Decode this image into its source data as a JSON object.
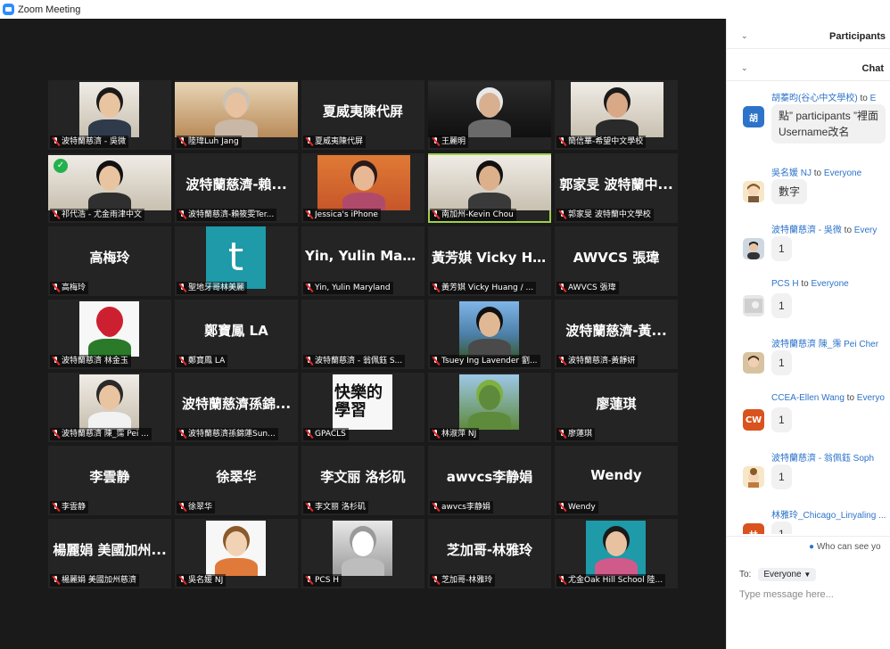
{
  "window": {
    "title": "Zoom Meeting"
  },
  "tiles": [
    {
      "label": "波特蘭慈濟 - 吳微",
      "big": ""
    },
    {
      "label": "陸瑋Luh Jang",
      "big": ""
    },
    {
      "label": "夏威夷陳代屏",
      "big": "夏威夷陳代屏"
    },
    {
      "label": "王麗明",
      "big": ""
    },
    {
      "label": "簡信華-希望中文學校",
      "big": ""
    },
    {
      "label": "祁代浩 - 尤金雨津中文",
      "big": ""
    },
    {
      "label": "波特蘭慈濟-賴筱雯Ter...",
      "big": "波特蘭慈濟-賴..."
    },
    {
      "label": "Jessica's iPhone",
      "big": ""
    },
    {
      "label": "南加州-Kevin Chou",
      "big": ""
    },
    {
      "label": "郭家旻 波特蘭中文學校",
      "big": "郭家旻 波特蘭中..."
    },
    {
      "label": "高梅玲",
      "big": "高梅玲"
    },
    {
      "label": "聖地牙哥林美麗",
      "big": ""
    },
    {
      "label": "Yin, Yulin  Maryland",
      "big": "Yin, Yulin  Maryl..."
    },
    {
      "label": "黃芳娸 Vicky Huang / ...",
      "big": "黃芳娸 Vicky Hu..."
    },
    {
      "label": "AWVCS 張瑋",
      "big": "AWVCS 張瑋"
    },
    {
      "label": "波特蘭慈濟 林金玉",
      "big": ""
    },
    {
      "label": "鄭寶鳳 LA",
      "big": "鄭寶鳳 LA"
    },
    {
      "label": "波特蘭慈濟 - 翁佩鈺 S...",
      "big": ""
    },
    {
      "label": "Tsuey Ing Lavender 劉...",
      "big": ""
    },
    {
      "label": "波特蘭慈濟-黃靜妍",
      "big": "波特蘭慈濟-黃..."
    },
    {
      "label": "波特蘭慈濟 陳_霈 Pei ...",
      "big": ""
    },
    {
      "label": "波特蘭慈濟孫錦蓮Sun...",
      "big": "波特蘭慈濟孫錦..."
    },
    {
      "label": "GPACLS",
      "big": ""
    },
    {
      "label": "林淑萍 NJ",
      "big": ""
    },
    {
      "label": "廖蓮琪",
      "big": "廖蓮琪"
    },
    {
      "label": "李雲静",
      "big": "李雲静"
    },
    {
      "label": "徐翠华",
      "big": "徐翠华"
    },
    {
      "label": "李文丽 洛杉矶",
      "big": "李文丽 洛杉矶"
    },
    {
      "label": "awvcs李静娟",
      "big": "awvcs李静娟"
    },
    {
      "label": "Wendy",
      "big": "Wendy"
    },
    {
      "label": "楊麗娟 美國加州慈濟",
      "big": "楊麗娟 美國加州..."
    },
    {
      "label": "吳名媛 NJ",
      "big": ""
    },
    {
      "label": "PCS H",
      "big": ""
    },
    {
      "label": "芝加哥-林雅玲",
      "big": "芝加哥-林雅玲"
    },
    {
      "label": "尤金Oak Hill School 陸...",
      "big": ""
    }
  ],
  "tile_logo_letter": "t",
  "calligraphy": "快樂的學習",
  "sidebar": {
    "participants_title": "Participants",
    "chat_title": "Chat",
    "messages": [
      {
        "from": "胡蓁昀(谷心中文學校)",
        "to_word": "to",
        "to": "E",
        "avatar_text": "胡",
        "text1": "點” participants ”裡面",
        "text2": "Username改名"
      },
      {
        "from": "吳名媛 NJ",
        "to_word": "to",
        "to": "Everyone",
        "avatar_text": "",
        "text1": "數字"
      },
      {
        "from": "波特蘭慈濟 - 吳微",
        "to_word": "to",
        "to": "Every",
        "avatar_text": "",
        "text1": "1"
      },
      {
        "from": "PCS H",
        "to_word": "to",
        "to": "Everyone",
        "avatar_text": "",
        "text1": "1"
      },
      {
        "from": "波特蘭慈濟 陳_霈 Pei Cher",
        "to_word": "",
        "to": "",
        "avatar_text": "",
        "text1": "1"
      },
      {
        "from": "CCEA-Ellen Wang",
        "to_word": "to",
        "to": "Everyo",
        "avatar_text": "CW",
        "text1": "1"
      },
      {
        "from": "波特蘭慈濟 - 翁佩鈺 Soph",
        "to_word": "",
        "to": "",
        "avatar_text": "",
        "text1": "1"
      },
      {
        "from": "林雅玲_Chicago_Linyaling ...",
        "to_word": "",
        "to": "",
        "avatar_text": "林",
        "text1": "1"
      }
    ],
    "who_can_see": "Who can see yo",
    "to_label": "To:",
    "to_value": "Everyone",
    "type_placeholder": "Type message here..."
  },
  "colors": {
    "accent": "#2d8cff",
    "active_border": "#9fd04a",
    "muted_mic": "#e02828",
    "link": "#2d73c9"
  }
}
